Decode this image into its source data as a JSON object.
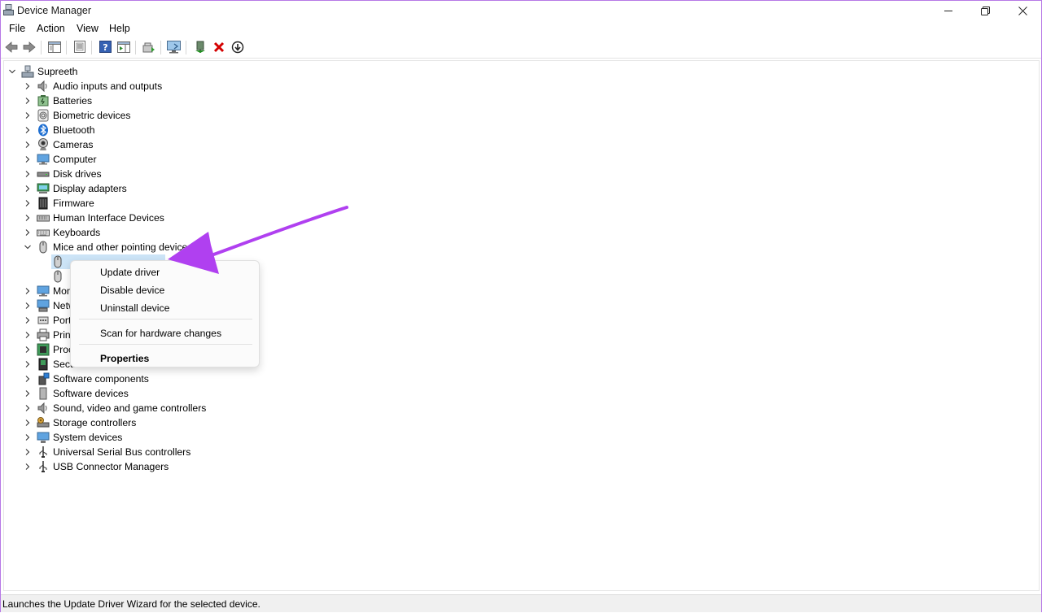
{
  "window": {
    "title": "Device Manager",
    "minimize_icon": "minimize-icon",
    "maximize_icon": "restore-icon",
    "close_icon": "close-icon"
  },
  "menu": {
    "items": [
      "File",
      "Action",
      "View",
      "Help"
    ]
  },
  "toolbar": {
    "buttons": [
      "back-arrow-icon",
      "forward-arrow-icon",
      "show-hide-console-tree-icon",
      "properties-icon",
      "help-icon",
      "action-pane-icon",
      "update-driver-icon",
      "scan-hardware-icon",
      "add-driver-icon",
      "uninstall-icon",
      "disable-icon"
    ]
  },
  "tree": {
    "root": "Supreeth",
    "categories": [
      "Audio inputs and outputs",
      "Batteries",
      "Biometric devices",
      "Bluetooth",
      "Cameras",
      "Computer",
      "Disk drives",
      "Display adapters",
      "Firmware",
      "Human Interface Devices",
      "Keyboards",
      "Mice and other pointing devices"
    ],
    "partial_categories": [
      "Mon",
      "Netw",
      "Port",
      "Prin",
      "Proc",
      "Secu"
    ],
    "remaining_categories": [
      "Software components",
      "Software devices",
      "Sound, video and game controllers",
      "Storage controllers",
      "System devices",
      "Universal Serial Bus controllers",
      "USB Connector Managers"
    ]
  },
  "context_menu": {
    "items": [
      "Update driver",
      "Disable device",
      "Uninstall device",
      "Scan for hardware changes",
      "Properties"
    ]
  },
  "status_bar": {
    "text": "Launches the Update Driver Wizard for the selected device."
  },
  "colors": {
    "window_border": "#b778e6",
    "annotation_arrow": "#b040f0",
    "selection": "#cce4f7",
    "close_red": "#d40000",
    "bluetooth_blue": "#1f6fd1"
  }
}
